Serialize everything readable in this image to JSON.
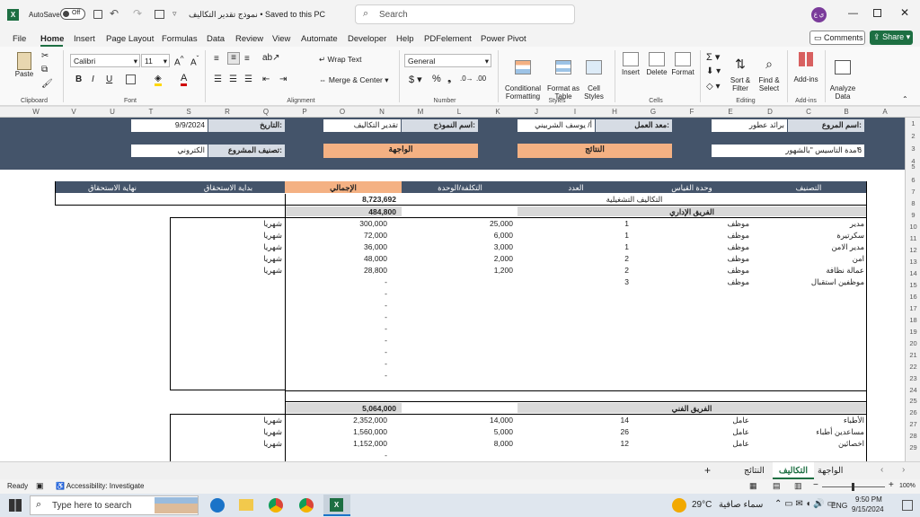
{
  "titlebar": {
    "autosave_label": "AutoSave",
    "autosave_state": "Off",
    "doc_title": "نموذج تقدير التكاليف • Saved to this PC",
    "search_placeholder": "Search",
    "user_initials": "ي ع"
  },
  "menu": [
    "File",
    "Home",
    "Insert",
    "Page Layout",
    "Formulas",
    "Data",
    "Review",
    "View",
    "Automate",
    "Developer",
    "Help",
    "PDFelement",
    "Power Pivot"
  ],
  "menu_active": "Home",
  "comments_label": "Comments",
  "share_label": "Share",
  "ribbon": {
    "paste": "Paste",
    "clipboard": "Clipboard",
    "font_name": "Calibri",
    "font_size": "11",
    "font_group": "Font",
    "wrap_text": "Wrap Text",
    "merge_center": "Merge & Center",
    "alignment": "Alignment",
    "number_format": "General",
    "number": "Number",
    "conditional": "Conditional\nFormatting",
    "format_table": "Format as\nTable",
    "cell_styles": "Cell\nStyles",
    "styles": "Styles",
    "insert": "Insert",
    "delete": "Delete",
    "format": "Format",
    "cells": "Cells",
    "sort_filter": "Sort &\nFilter",
    "find_select": "Find &\nSelect",
    "editing": "Editing",
    "addins": "Add-ins",
    "addins_grp": "Add-ins",
    "analyze": "Analyze\nData"
  },
  "columns": [
    "W",
    "V",
    "U",
    "T",
    "S",
    "R",
    "Q",
    "P",
    "O",
    "N",
    "M",
    "L",
    "K",
    "J",
    "I",
    "H",
    "G",
    "F",
    "E",
    "D",
    "C",
    "B",
    "A"
  ],
  "rows": [
    "1",
    "2",
    "3",
    "4",
    "5",
    "6",
    "7",
    "8",
    "9",
    "10",
    "11",
    "12",
    "13",
    "14",
    "15",
    "16",
    "17",
    "18",
    "19",
    "20",
    "21",
    "22",
    "23",
    "24",
    "25",
    "26",
    "27",
    "28",
    "29"
  ],
  "header": {
    "brand_label": "اسم المروع:",
    "brand_value": "برائد عطور",
    "worker_label": "معد العمل:",
    "worker_value": "أ/ يوسف الشربيني",
    "model_label": "اسم النموذج:",
    "model_value": "تقدير التكاليف",
    "date_label": "التاريخ:",
    "date_value": "9/9/2024",
    "duration_label": "مدة التاسيس \"بالشهور\":",
    "duration_value": "6",
    "results_btn": "النتائج",
    "interface_btn": "الواجهة",
    "class_label": "تصنيف المشروع:",
    "class_value": "الكتروني"
  },
  "table_head": [
    "التصنيف",
    "وحدة القياس",
    "العدد",
    "التكلفة/الوحدة",
    "الإجمالي",
    "بداية الاستحقاق",
    "نهاية الاستحقاق"
  ],
  "op_costs_label": "التكاليف التشغيلية",
  "op_costs_total": "8,723,692",
  "admin": {
    "label": "الفريق الإداري",
    "total": "484,800",
    "rows": [
      {
        "name": "مدير",
        "unit": "موظف",
        "count": "1",
        "cost": "25,000",
        "total": "300,000",
        "start": "شهريا"
      },
      {
        "name": "سكرتيرة",
        "unit": "موظف",
        "count": "1",
        "cost": "6,000",
        "total": "72,000",
        "start": "شهريا"
      },
      {
        "name": "مدير الامن",
        "unit": "موظف",
        "count": "1",
        "cost": "3,000",
        "total": "36,000",
        "start": "شهريا"
      },
      {
        "name": "امن",
        "unit": "موظف",
        "count": "2",
        "cost": "2,000",
        "total": "48,000",
        "start": "شهريا"
      },
      {
        "name": "عمالة نظافة",
        "unit": "موظف",
        "count": "2",
        "cost": "1,200",
        "total": "28,800",
        "start": "شهريا"
      },
      {
        "name": "موظفين استقبال",
        "unit": "موظف",
        "count": "3",
        "cost": "",
        "total": "-",
        "start": ""
      },
      {
        "name": "",
        "unit": "",
        "count": "",
        "cost": "",
        "total": "-",
        "start": ""
      },
      {
        "name": "",
        "unit": "",
        "count": "",
        "cost": "",
        "total": "-",
        "start": ""
      },
      {
        "name": "",
        "unit": "",
        "count": "",
        "cost": "",
        "total": "-",
        "start": ""
      },
      {
        "name": "",
        "unit": "",
        "count": "",
        "cost": "",
        "total": "-",
        "start": ""
      },
      {
        "name": "",
        "unit": "",
        "count": "",
        "cost": "",
        "total": "-",
        "start": ""
      },
      {
        "name": "",
        "unit": "",
        "count": "",
        "cost": "",
        "total": "-",
        "start": ""
      },
      {
        "name": "",
        "unit": "",
        "count": "",
        "cost": "",
        "total": "-",
        "start": ""
      },
      {
        "name": "",
        "unit": "",
        "count": "",
        "cost": "",
        "total": "-",
        "start": ""
      }
    ]
  },
  "tech": {
    "label": "الفريق الفني",
    "total": "5,064,000",
    "rows": [
      {
        "name": "الأطباء",
        "unit": "عامل",
        "count": "14",
        "cost": "14,000",
        "total": "2,352,000",
        "start": "شهريا"
      },
      {
        "name": "مساعدين أطباء",
        "unit": "عامل",
        "count": "26",
        "cost": "5,000",
        "total": "1,560,000",
        "start": "شهريا"
      },
      {
        "name": "اخصائين",
        "unit": "عامل",
        "count": "12",
        "cost": "8,000",
        "total": "1,152,000",
        "start": "شهريا"
      },
      {
        "name": "",
        "unit": "",
        "count": "",
        "cost": "",
        "total": "-",
        "start": ""
      }
    ]
  },
  "sheets": {
    "tab1": "التكاليف",
    "tab2": "النتائج",
    "tab3": "الواجهة"
  },
  "status": {
    "ready": "Ready",
    "accessibility": "Accessibility: Investigate",
    "zoom": "100%"
  },
  "taskbar": {
    "search": "Type here to search",
    "temp": "29°C",
    "weather": "سماء صافية",
    "lang": "ENG",
    "time": "9:50 PM",
    "date": "9/15/2024"
  }
}
